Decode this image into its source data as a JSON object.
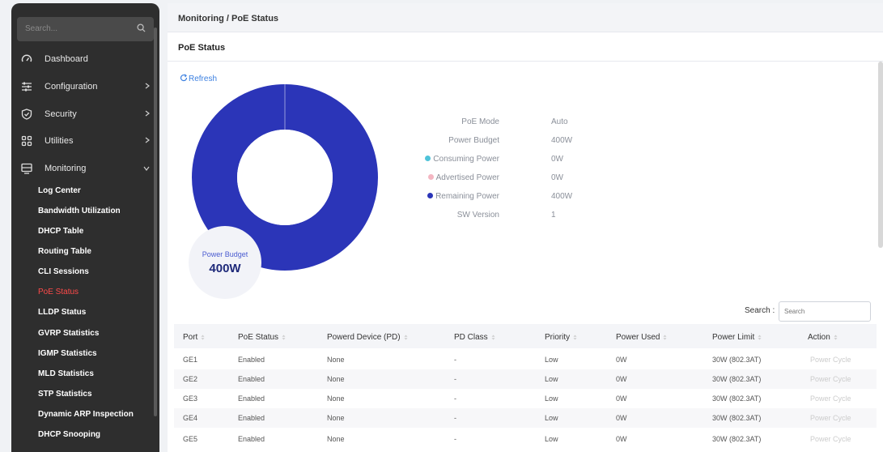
{
  "sidebar": {
    "search_placeholder": "Search...",
    "menu": [
      {
        "label": "Dashboard"
      },
      {
        "label": "Configuration"
      },
      {
        "label": "Security"
      },
      {
        "label": "Utilities"
      },
      {
        "label": "Monitoring"
      }
    ],
    "monitoring_items": [
      {
        "label": "Log Center"
      },
      {
        "label": "Bandwidth Utilization"
      },
      {
        "label": "DHCP Table"
      },
      {
        "label": "Routing Table"
      },
      {
        "label": "CLI Sessions"
      },
      {
        "label": "PoE Status"
      },
      {
        "label": "LLDP Status"
      },
      {
        "label": "GVRP Statistics"
      },
      {
        "label": "IGMP Statistics"
      },
      {
        "label": "MLD Statistics"
      },
      {
        "label": "STP Statistics"
      },
      {
        "label": "Dynamic ARP Inspection"
      },
      {
        "label": "DHCP Snooping"
      }
    ]
  },
  "breadcrumb": "Monitoring / PoE Status",
  "page_title": "PoE Status",
  "refresh_label": "Refresh",
  "donut": {
    "center_label": "Power Budget",
    "center_value": "400W",
    "remaining_fraction": 1.0,
    "colors": {
      "remaining": "#2b35b8",
      "consuming": "#4fc3d9",
      "advertised": "#f4b6c2",
      "inner": "#ffffff"
    }
  },
  "info": {
    "poe_mode": {
      "key": "PoE Mode",
      "value": "Auto"
    },
    "power_budget": {
      "key": "Power Budget",
      "value": "400W"
    },
    "consuming": {
      "key": "Consuming Power",
      "value": "0W"
    },
    "advertised": {
      "key": "Advertised Power",
      "value": "0W"
    },
    "remaining": {
      "key": "Remaining Power",
      "value": "400W"
    },
    "sw_version": {
      "key": "SW Version",
      "value": "1"
    }
  },
  "table": {
    "search_label": "Search :",
    "search_placeholder": "Search",
    "columns": [
      "Port",
      "PoE Status",
      "Powerd Device (PD)",
      "PD Class",
      "Priority",
      "Power Used",
      "Power Limit",
      "Action"
    ],
    "rows": [
      [
        "GE1",
        "Enabled",
        "None",
        "-",
        "Low",
        "0W",
        "30W (802.3AT)",
        "Power Cycle"
      ],
      [
        "GE2",
        "Enabled",
        "None",
        "-",
        "Low",
        "0W",
        "30W (802.3AT)",
        "Power Cycle"
      ],
      [
        "GE3",
        "Enabled",
        "None",
        "-",
        "Low",
        "0W",
        "30W (802.3AT)",
        "Power Cycle"
      ],
      [
        "GE4",
        "Enabled",
        "None",
        "-",
        "Low",
        "0W",
        "30W (802.3AT)",
        "Power Cycle"
      ],
      [
        "GE5",
        "Enabled",
        "None",
        "-",
        "Low",
        "0W",
        "30W (802.3AT)",
        "Power Cycle"
      ]
    ]
  }
}
